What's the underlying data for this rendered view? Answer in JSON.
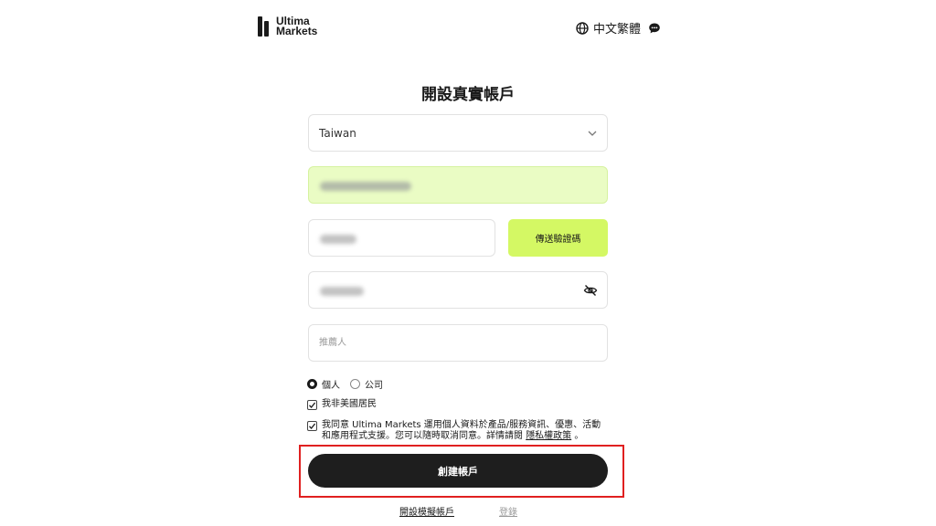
{
  "header": {
    "logo": {
      "line1": "Ultima",
      "line2": "Markets"
    },
    "language_label": "中文繁體"
  },
  "form": {
    "title": "開設真實帳戶",
    "country_value": "Taiwan",
    "send_code_label": "傳送驗證碼",
    "referrer_placeholder": "推薦人",
    "account_types": [
      {
        "label": "個人",
        "checked": true
      },
      {
        "label": "公司",
        "checked": false
      }
    ],
    "not_us_resident_label": "我非美國居民",
    "consent_text": "我同意 Ultima Markets 運用個人資料於產品/服務資訊、優惠、活動和應用程式支援。您可以隨時取消同意。詳情請閱 ",
    "privacy_link": "隱私權政策",
    "consent_suffix": " 。",
    "create_button": "創建帳戶"
  },
  "footer": {
    "demo_link": "開設模擬帳戶",
    "login_link": "登錄"
  },
  "colors": {
    "accent_green": "#d4f864",
    "email_bg": "#eafcc4",
    "button_dark": "#1e1e1e",
    "highlight_red": "#e02020"
  }
}
